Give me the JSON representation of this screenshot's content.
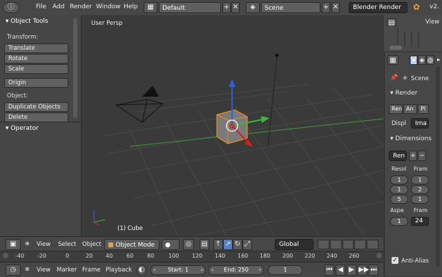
{
  "topbar": {
    "menus": [
      "File",
      "Add",
      "Render",
      "Window",
      "Help"
    ],
    "layout": "Default",
    "scene": "Scene",
    "engine": "Blender Render",
    "version": "v2."
  },
  "tools": {
    "title": "Object Tools",
    "transform_label": "Transform:",
    "transform_buttons": [
      "Translate",
      "Rotate",
      "Scale"
    ],
    "origin_button": "Origin",
    "object_label": "Object:",
    "object_buttons": [
      "Duplicate Objects",
      "Delete"
    ],
    "operator_title": "Operator"
  },
  "viewport": {
    "view_name": "User Persp",
    "selected_label": "(1) Cube"
  },
  "view3d_header": {
    "menus": [
      "View",
      "Select",
      "Object"
    ],
    "mode": "Object Mode",
    "orientation": "Global"
  },
  "ruler": {
    "ticks": [
      "-40",
      "-20",
      "0",
      "20",
      "40",
      "60",
      "80",
      "100",
      "120",
      "140",
      "160",
      "180",
      "200",
      "220",
      "240",
      "260"
    ]
  },
  "timeline": {
    "menus": [
      "View",
      "Marker",
      "Frame",
      "Playback"
    ],
    "start": "Start: 1",
    "end": "End: 250",
    "current": "1"
  },
  "outliner": {
    "view_label": "View"
  },
  "properties": {
    "scene_label": "Scene",
    "render_title": "Render",
    "render_btn": "Ren",
    "anim_btn": "An",
    "play_btn": "Pl",
    "display_label": "Displ",
    "display_value": "Ima",
    "dimensions_title": "Dimensions",
    "presets_value": "Ren",
    "resolution_label": "Resol",
    "frame_label": "Fram",
    "res_values": [
      "1",
      "1",
      "5"
    ],
    "frame_values": [
      "1",
      "2",
      "1"
    ],
    "aspect_label": "Aspe",
    "frame_rate_label": "Fram",
    "aspect_value": "1",
    "fps_value": "24",
    "antialias_label": "Anti-Alias"
  }
}
